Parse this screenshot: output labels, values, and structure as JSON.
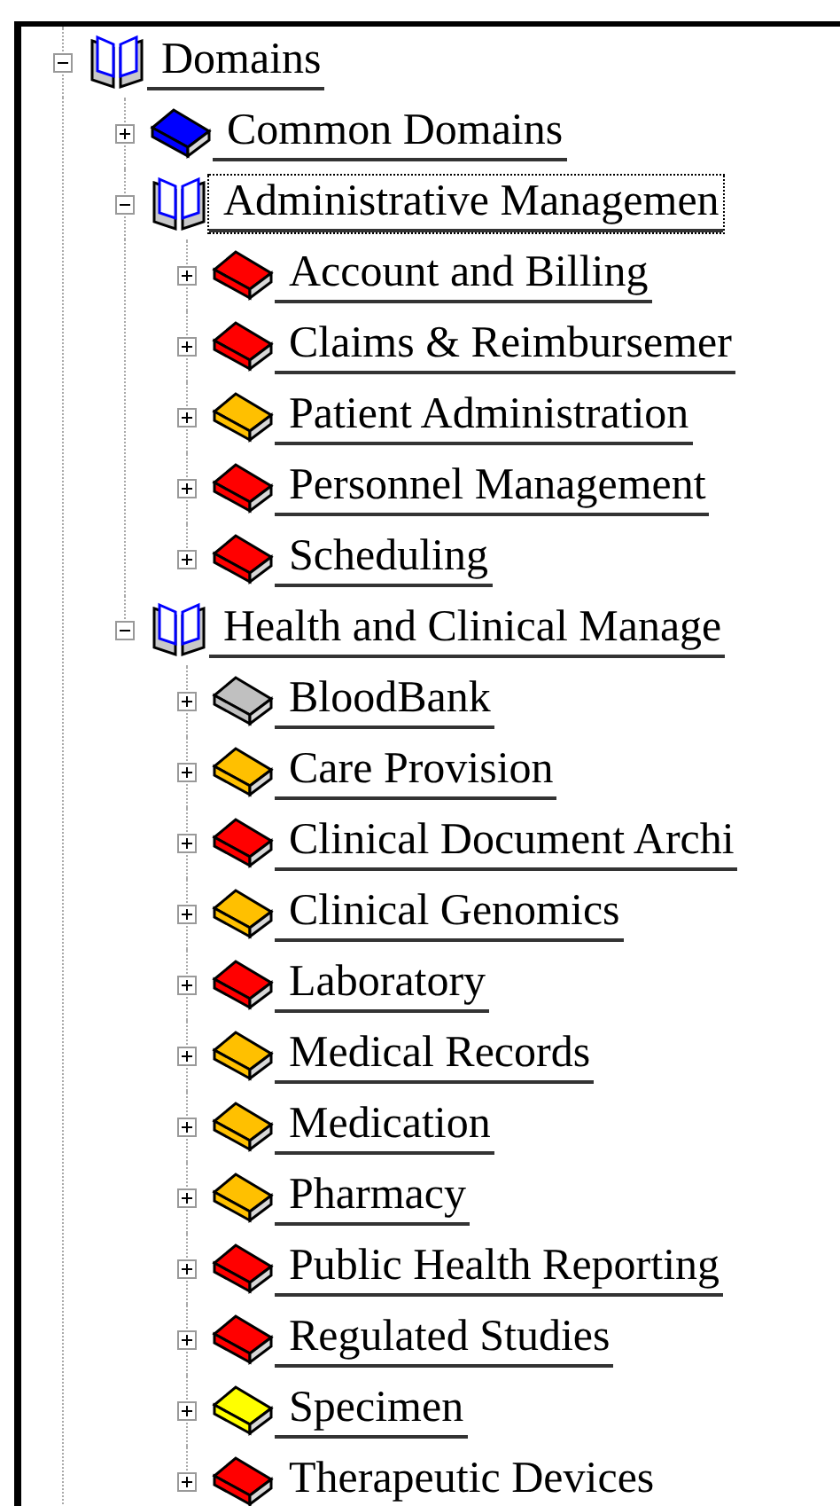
{
  "tree": [
    {
      "label": "Domains",
      "expanded": true,
      "selected": false,
      "children": [
        {
          "label": "Common Domains",
          "expanded": false,
          "selected": false,
          "color": "#0000ff"
        },
        {
          "label": "Administrative Managemen",
          "expanded": true,
          "selected": true,
          "children": [
            {
              "label": "Account and Billing",
              "expanded": false,
              "selected": false,
              "color": "#ff0000"
            },
            {
              "label": "Claims & Reimbursemer",
              "expanded": false,
              "selected": false,
              "color": "#ff0000"
            },
            {
              "label": "Patient Administration",
              "expanded": false,
              "selected": false,
              "color": "#ffc000"
            },
            {
              "label": "Personnel Management",
              "expanded": false,
              "selected": false,
              "color": "#ff0000"
            },
            {
              "label": "Scheduling",
              "expanded": false,
              "selected": false,
              "color": "#ff0000"
            }
          ]
        },
        {
          "label": "Health and Clinical Manage",
          "expanded": true,
          "selected": false,
          "children": [
            {
              "label": "BloodBank",
              "expanded": false,
              "selected": false,
              "color": "#c0c0c0"
            },
            {
              "label": "Care Provision",
              "expanded": false,
              "selected": false,
              "color": "#ffc000"
            },
            {
              "label": "Clinical Document Archi",
              "expanded": false,
              "selected": false,
              "color": "#ff0000"
            },
            {
              "label": "Clinical Genomics",
              "expanded": false,
              "selected": false,
              "color": "#ffc000"
            },
            {
              "label": "Laboratory",
              "expanded": false,
              "selected": false,
              "color": "#ff0000"
            },
            {
              "label": "Medical Records",
              "expanded": false,
              "selected": false,
              "color": "#ffc000"
            },
            {
              "label": "Medication",
              "expanded": false,
              "selected": false,
              "color": "#ffc000"
            },
            {
              "label": "Pharmacy",
              "expanded": false,
              "selected": false,
              "color": "#ffc000"
            },
            {
              "label": "Public Health Reporting",
              "expanded": false,
              "selected": false,
              "color": "#ff0000"
            },
            {
              "label": "Regulated Studies",
              "expanded": false,
              "selected": false,
              "color": "#ff0000"
            },
            {
              "label": "Specimen",
              "expanded": false,
              "selected": false,
              "color": "#ffff00"
            },
            {
              "label": "Therapeutic Devices",
              "expanded": false,
              "selected": false,
              "color": "#ff0000"
            }
          ]
        }
      ]
    }
  ]
}
